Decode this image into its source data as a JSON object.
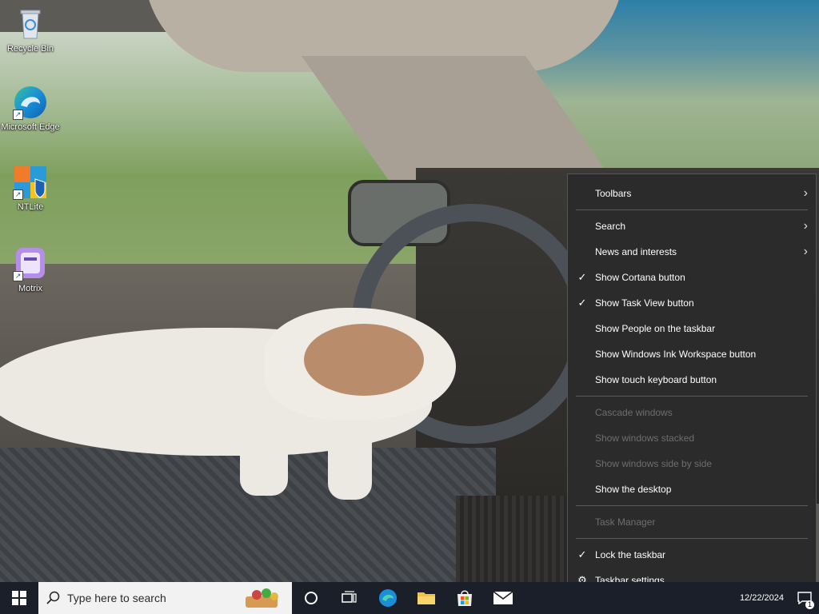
{
  "desktop": {
    "icons": [
      {
        "label": "Recycle Bin",
        "icon": "recycle-bin-icon"
      },
      {
        "label": "Microsoft Edge",
        "icon": "edge-icon"
      },
      {
        "label": "NTLite",
        "icon": "ntlite-icon"
      },
      {
        "label": "Motrix",
        "icon": "motrix-icon"
      }
    ]
  },
  "context_menu": {
    "items": [
      {
        "label": "Toolbars",
        "checked": false,
        "submenu": true,
        "enabled": true
      },
      {
        "label": "Search",
        "checked": false,
        "submenu": true,
        "enabled": true
      },
      {
        "label": "News and interests",
        "checked": false,
        "submenu": true,
        "enabled": true
      },
      {
        "label": "Show Cortana button",
        "checked": true,
        "submenu": false,
        "enabled": true
      },
      {
        "label": "Show Task View button",
        "checked": true,
        "submenu": false,
        "enabled": true
      },
      {
        "label": "Show People on the taskbar",
        "checked": false,
        "submenu": false,
        "enabled": true
      },
      {
        "label": "Show Windows Ink Workspace button",
        "checked": false,
        "submenu": false,
        "enabled": true
      },
      {
        "label": "Show touch keyboard button",
        "checked": false,
        "submenu": false,
        "enabled": true
      },
      {
        "label": "Cascade windows",
        "checked": false,
        "submenu": false,
        "enabled": false
      },
      {
        "label": "Show windows stacked",
        "checked": false,
        "submenu": false,
        "enabled": false
      },
      {
        "label": "Show windows side by side",
        "checked": false,
        "submenu": false,
        "enabled": false
      },
      {
        "label": "Show the desktop",
        "checked": false,
        "submenu": false,
        "enabled": true
      },
      {
        "label": "Task Manager",
        "checked": false,
        "submenu": false,
        "enabled": false
      },
      {
        "label": "Lock the taskbar",
        "checked": true,
        "submenu": false,
        "enabled": true
      },
      {
        "label": "Taskbar settings",
        "checked": false,
        "submenu": false,
        "enabled": true,
        "icon": "gear-icon"
      }
    ],
    "check_glyph": "✓",
    "arrow_glyph": "›",
    "gear_glyph": "⚙"
  },
  "taskbar": {
    "search_placeholder": "Type here to search",
    "pinned": [
      "cortana-icon",
      "task-view-icon",
      "edge-icon",
      "file-explorer-icon",
      "microsoft-store-icon",
      "mail-icon"
    ],
    "clock_date": "12/22/2024",
    "notification_count": "1"
  },
  "colors": {
    "menu_bg": "#2b2b2b",
    "taskbar_bg": "#1a1f29",
    "disabled_text": "#6e6e6e"
  }
}
